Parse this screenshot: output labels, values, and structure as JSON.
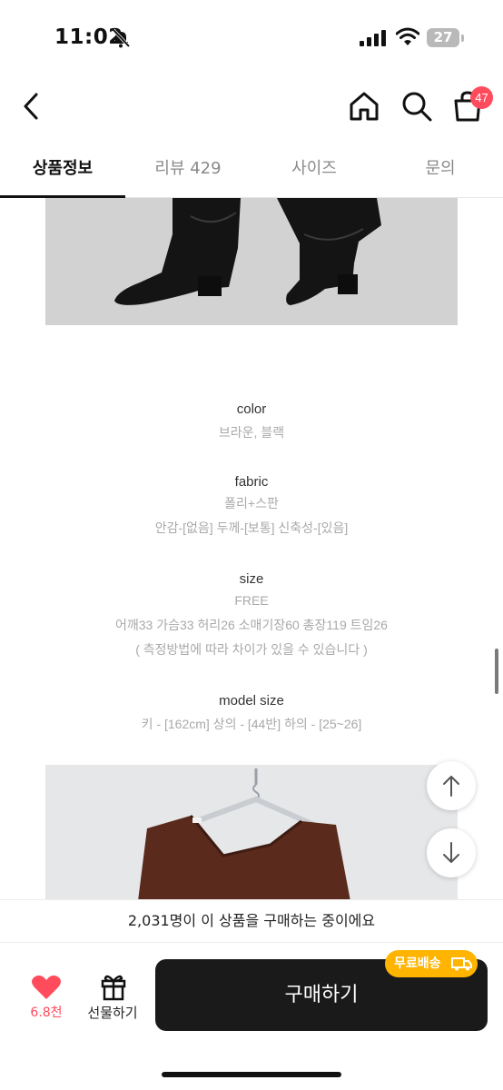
{
  "status_bar": {
    "time": "11:02",
    "battery": "27"
  },
  "nav": {
    "cart_count": "47"
  },
  "tabs": [
    {
      "label": "상품정보"
    },
    {
      "label": "리뷰 429"
    },
    {
      "label": "사이즈"
    },
    {
      "label": "문의"
    }
  ],
  "product_info": {
    "color_title": "color",
    "color_value": "브라운, 블랙",
    "fabric_title": "fabric",
    "fabric_value": "폴리+스판",
    "fabric_detail": "안감-[없음] 두께-[보통] 신축성-[있음]",
    "size_title": "size",
    "size_value": "FREE",
    "size_detail": "어깨33 가슴33 허리26 소매기장60 총장119 트임26",
    "size_note": "( 측정방법에 따라 차이가 있을 수 있습니다 )",
    "model_title": "model size",
    "model_value": "키 - [162cm] 상의 - [44반] 하의 - [25~26]"
  },
  "bottom": {
    "buyers_text": "2,031명이 이 상품을 구매하는 중이에요",
    "like_count": "6.8천",
    "gift_label": "선물하기",
    "buy_label": "구매하기",
    "free_shipping": "무료배송"
  },
  "colors": {
    "accent": "#ff4b5c",
    "badge": "#ffb400",
    "button": "#1a1a1a"
  }
}
